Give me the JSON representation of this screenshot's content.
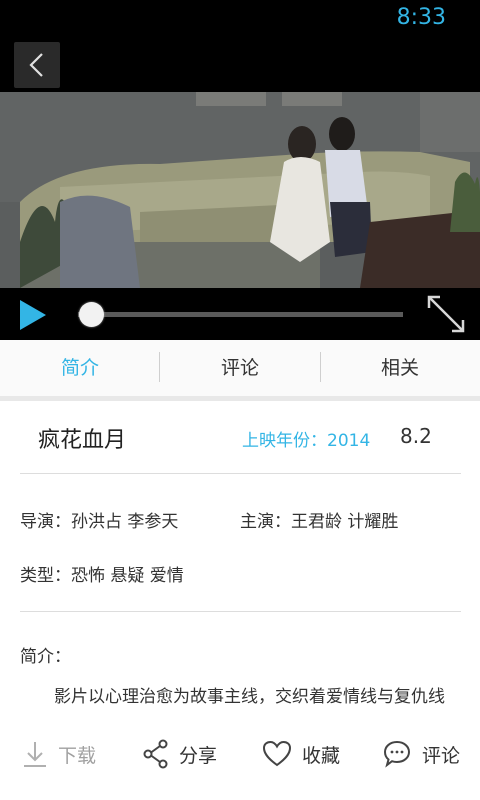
{
  "status_bar": {
    "time": "8:33"
  },
  "tabs": [
    {
      "label": "简介",
      "active": true
    },
    {
      "label": "评论",
      "active": false
    },
    {
      "label": "相关",
      "active": false
    }
  ],
  "movie": {
    "title": "疯花血月",
    "year_label": "上映年份：2014",
    "rating": "8.2",
    "director_label": "导演：孙洪占 李参天",
    "cast_label": "主演：王君龄 计耀胜",
    "genre_label": "类型：恐怖 悬疑 爱情",
    "synopsis_heading": "简介：",
    "synopsis": "影片以心理治愈为故事主线，交织着爱情线与复仇线"
  },
  "player": {
    "progress": 0.0
  },
  "bottom_bar": {
    "download": "下载",
    "share": "分享",
    "favorite": "收藏",
    "comment": "评论"
  },
  "colors": {
    "accent": "#33b5e5",
    "status_bg": "#000000"
  }
}
